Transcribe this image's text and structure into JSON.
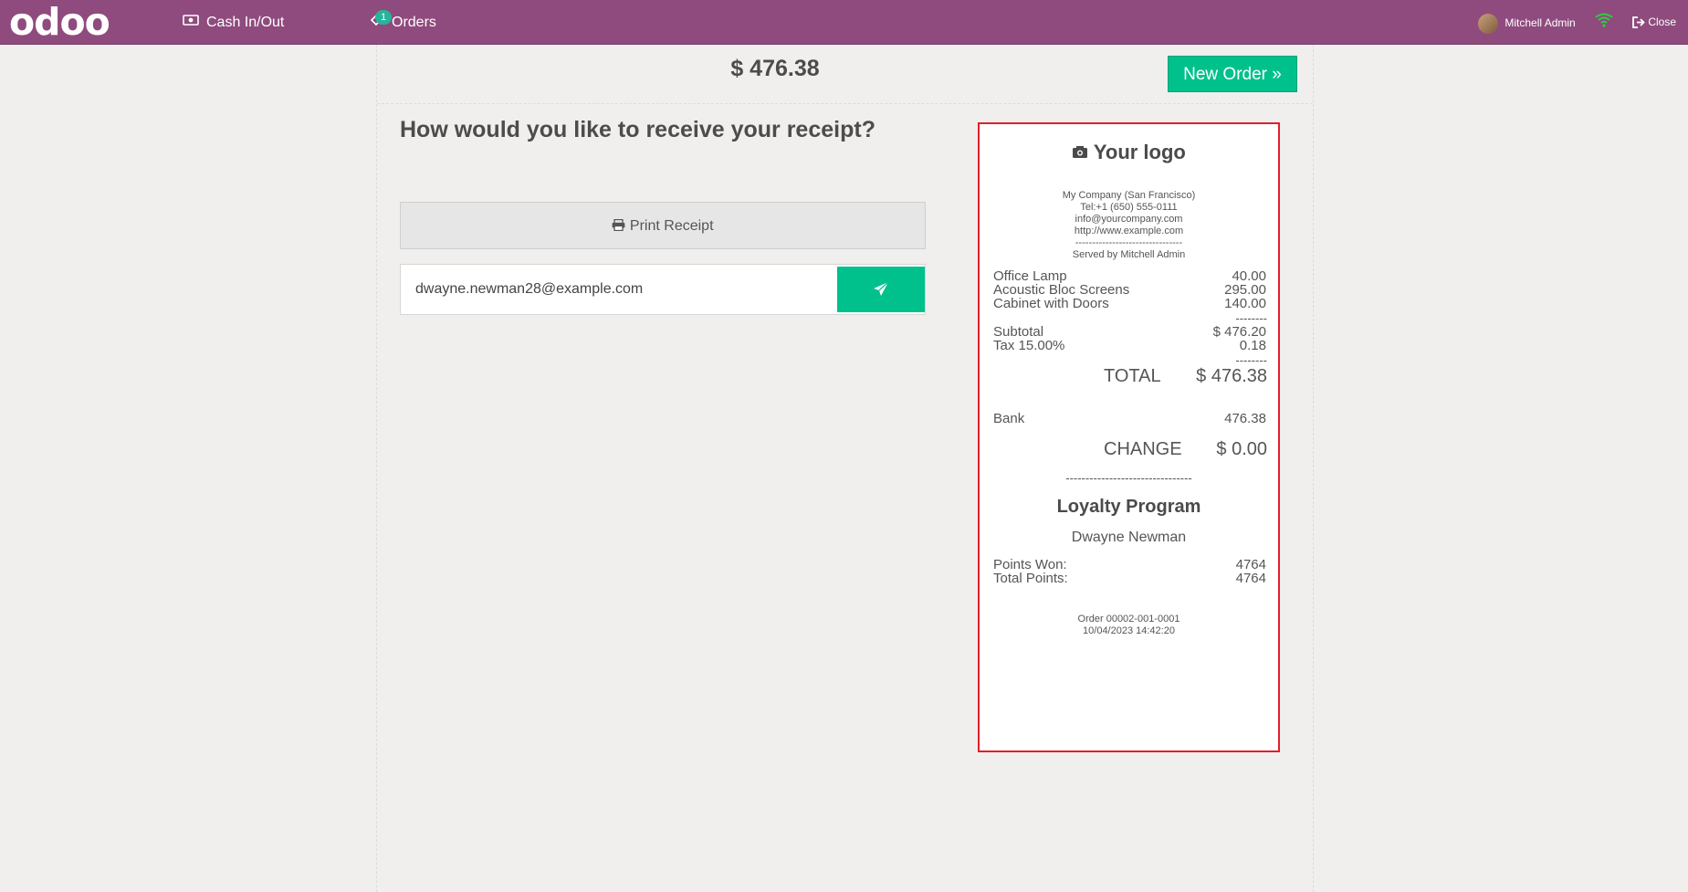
{
  "navbar": {
    "logo": "odoo",
    "cash_label": "Cash In/Out",
    "orders_label": "Orders",
    "orders_badge": "1",
    "user_name": "Mitchell Admin",
    "close_label": "Close",
    "wifi_status_color": "#2ecc40",
    "brand_color": "#8f4b7d"
  },
  "screen": {
    "total": "$ 476.38",
    "new_order_label": "New Order",
    "question": "How would you like to receive your receipt?",
    "print_label": "Print Receipt",
    "email_value": "dwayne.newman28@example.com",
    "accent_color": "#00c18c"
  },
  "receipt": {
    "logo_text": "Your logo",
    "company_lines": [
      "My Company (San Francisco)",
      "Tel:+1 (650) 555-0111",
      "info@yourcompany.com",
      "http://www.example.com",
      "--------------------------------",
      "Served by Mitchell Admin"
    ],
    "lines": [
      {
        "name": "Office Lamp",
        "amount": "40.00"
      },
      {
        "name": "Acoustic Bloc Screens",
        "amount": "295.00"
      },
      {
        "name": "Cabinet with Doors",
        "amount": "140.00"
      }
    ],
    "dash_short": "--------",
    "subtotal_label": "Subtotal",
    "subtotal_value": "$ 476.20",
    "tax_label": "Tax 15.00%",
    "tax_value": "0.18",
    "total_label": "TOTAL",
    "total_value": "$ 476.38",
    "payment_label": "Bank",
    "payment_value": "476.38",
    "change_label": "CHANGE",
    "change_value": "$ 0.00",
    "separator": "--------------------------------",
    "loyalty_title": "Loyalty Program",
    "customer": "Dwayne Newman",
    "points_won_label": "Points Won:",
    "points_won_value": "4764",
    "total_points_label": "Total Points:",
    "total_points_value": "4764",
    "order_ref": "Order 00002-001-0001",
    "order_date": "10/04/2023 14:42:20"
  }
}
